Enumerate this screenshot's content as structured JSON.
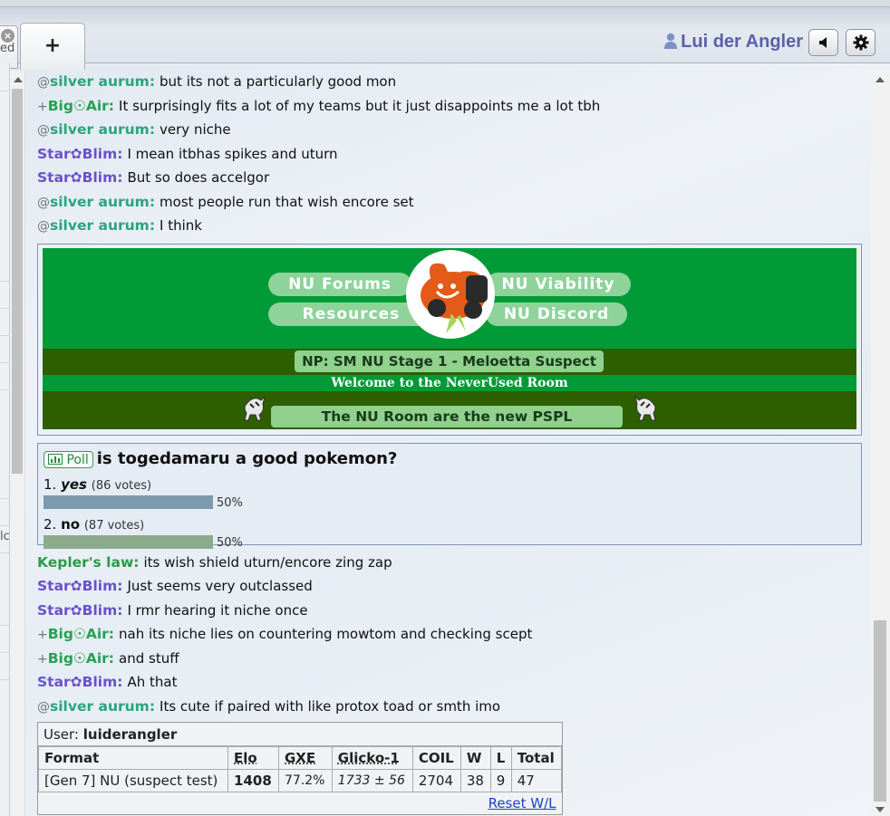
{
  "header": {
    "partial_tab_text": "ed",
    "new_tab_label": "+",
    "username": "Lui der Angler",
    "icons": [
      "close-icon",
      "user-icon",
      "volume-icon",
      "gear-icon"
    ]
  },
  "left_fragment": "lc",
  "chat_before": [
    {
      "rank": "@",
      "name": "silver aurum:",
      "color": "#2aa57c",
      "text": "but its not a particularly good mon"
    },
    {
      "rank": "+",
      "name": "Big☉Air:",
      "color": "#27a152",
      "text": "It surprisingly fits a lot of my teams but it just disappoints me a lot tbh"
    },
    {
      "rank": "@",
      "name": "silver aurum:",
      "color": "#2aa57c",
      "text": "very niche"
    },
    {
      "rank": "",
      "name": "Star✿Blim:",
      "color": "#6a52c9",
      "text": "I mean itbhas spikes and uturn"
    },
    {
      "rank": "",
      "name": "Star✿Blim:",
      "color": "#6a52c9",
      "text": "But so does accelgor"
    },
    {
      "rank": "@",
      "name": "silver aurum:",
      "color": "#2aa57c",
      "text": "most people run that wish encore set"
    },
    {
      "rank": "@",
      "name": "silver aurum:",
      "color": "#2aa57c",
      "text": "I think"
    }
  ],
  "banner": {
    "links": [
      "NU Forums",
      "NU Viability",
      "Resources",
      "NU Discord"
    ],
    "np_text": "NP: SM NU Stage 1 - Meloetta Suspect",
    "welcome_text": "Welcome to the NeverUsed Room",
    "news_text": "The NU Room are the new PSPL Champions!!"
  },
  "poll": {
    "badge": "Poll",
    "question": "is togedamaru a good pokemon?",
    "options": [
      {
        "label": "1. ",
        "name": "yes",
        "votes": "(86 votes)",
        "percent_text": "50%",
        "fraction": 0.5,
        "color": "#7b9aae"
      },
      {
        "label": "2. ",
        "name": "no",
        "votes": "(87 votes)",
        "percent_text": "50%",
        "fraction": 0.5,
        "color": "#8bab8c"
      }
    ]
  },
  "chat_after": [
    {
      "rank": "",
      "name": "Kepler's law:",
      "color": "#2c9a46",
      "text": "its wish shield uturn/encore zing zap"
    },
    {
      "rank": "",
      "name": "Star✿Blim:",
      "color": "#6a52c9",
      "text": "Just seems very outclassed"
    },
    {
      "rank": "",
      "name": "Star✿Blim:",
      "color": "#6a52c9",
      "text": "I rmr hearing it niche once"
    },
    {
      "rank": "+",
      "name": "Big☉Air:",
      "color": "#27a152",
      "text": "nah its niche lies on countering mowtom and checking scept"
    },
    {
      "rank": "+",
      "name": "Big☉Air:",
      "color": "#27a152",
      "text": "and stuff"
    },
    {
      "rank": "",
      "name": "Star✿Blim:",
      "color": "#6a52c9",
      "text": "Ah that"
    },
    {
      "rank": "@",
      "name": "silver aurum:",
      "color": "#2aa57c",
      "text": "Its cute if paired with like protox toad or smth imo"
    }
  ],
  "user_table": {
    "user_label": "User: ",
    "username": "luiderangler",
    "headers": [
      "Format",
      "Elo",
      "GXE",
      "Glicko-1",
      "COIL",
      "W",
      "L",
      "Total"
    ],
    "row": {
      "format": "[Gen 7] NU (suspect test)",
      "elo": "1408",
      "gxe": "77.2%",
      "glicko": "1733 ± 56",
      "coil": "2704",
      "w": "38",
      "l": "9",
      "total": "47"
    },
    "reset_label": "Reset W/L"
  }
}
